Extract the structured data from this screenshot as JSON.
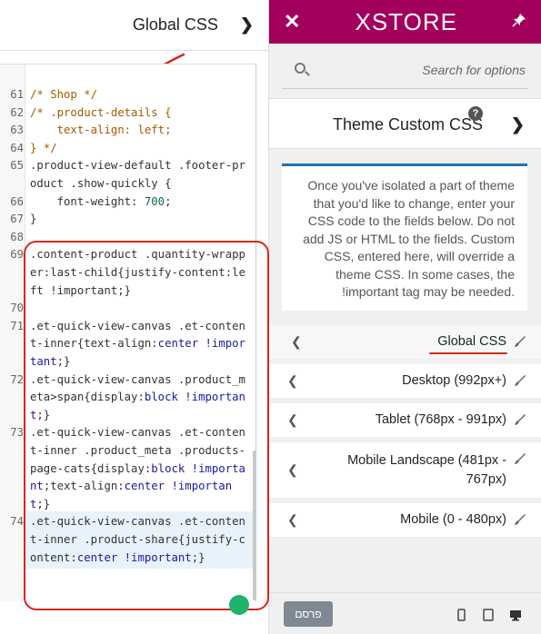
{
  "left_panel": {
    "title": "Global CSS",
    "code_lines": [
      {
        "n": "61",
        "parts": [
          {
            "t": "/* Shop */",
            "c": "cmt"
          }
        ]
      },
      {
        "n": "62",
        "parts": [
          {
            "t": "/* .product-details {",
            "c": "cmt"
          }
        ]
      },
      {
        "n": "63",
        "parts": [
          {
            "t": "    text-align: left;",
            "c": "cmt"
          }
        ]
      },
      {
        "n": "64",
        "parts": [
          {
            "t": "} */",
            "c": "cmt"
          }
        ]
      },
      {
        "n": "65",
        "parts": [
          {
            "t": ".product-view-default .footer-product .show-quickly {",
            "c": ""
          }
        ]
      },
      {
        "n": "66",
        "parts": [
          {
            "t": "    font-weight: ",
            "c": ""
          },
          {
            "t": "700",
            "c": "num"
          },
          {
            "t": ";",
            "c": ""
          }
        ]
      },
      {
        "n": "67",
        "parts": [
          {
            "t": "}",
            "c": ""
          }
        ]
      },
      {
        "n": "68",
        "parts": [
          {
            "t": "",
            "c": ""
          }
        ]
      },
      {
        "n": "69",
        "parts": [
          {
            "t": ".content-product .quantity-wrapper:last-child{justify-content:left !important;}",
            "c": ""
          }
        ]
      },
      {
        "n": "70",
        "parts": [
          {
            "t": "",
            "c": ""
          }
        ]
      },
      {
        "n": "71",
        "parts": [
          {
            "t": ".et-quick-view-canvas .et-content-inner{text-align:",
            "c": ""
          },
          {
            "t": "center !important",
            "c": "kw"
          },
          {
            "t": ";}",
            "c": ""
          }
        ]
      },
      {
        "n": "72",
        "parts": [
          {
            "t": ".et-quick-view-canvas .product_meta>span{display:",
            "c": ""
          },
          {
            "t": "block !important",
            "c": "kw"
          },
          {
            "t": ";}",
            "c": ""
          }
        ]
      },
      {
        "n": "73",
        "parts": [
          {
            "t": ".et-quick-view-canvas .et-content-inner .product_meta .products-page-cats{display:",
            "c": ""
          },
          {
            "t": "block !important",
            "c": "kw"
          },
          {
            "t": ";text-align:",
            "c": ""
          },
          {
            "t": "center !important",
            "c": "kw"
          },
          {
            "t": ";}",
            "c": ""
          }
        ]
      },
      {
        "n": "74",
        "parts": [
          {
            "t": ".et-quick-view-canvas .et-content-inner .product-share{justify-content:",
            "c": ""
          },
          {
            "t": "center !important",
            "c": "kw"
          },
          {
            "t": ";}",
            "c": ""
          }
        ]
      }
    ]
  },
  "topbar": {
    "logo": "XSTORE",
    "close_label": "✕",
    "pin_label": "📌"
  },
  "search": {
    "placeholder": "Search for options"
  },
  "section": {
    "title": "Theme Custom CSS",
    "help": "?"
  },
  "notice": "Once you've isolated a part of theme that you'd like to change, enter your CSS code to the fields below. Do not add JS or HTML to the fields. Custom CSS, entered here, will override a theme CSS. In some cases, the !important tag may be needed.",
  "nav": [
    {
      "label": "Global CSS"
    },
    {
      "label": "Desktop (992px+)"
    },
    {
      "label": "Tablet (768px - 991px)"
    },
    {
      "label": "Mobile Landscape (481px - 767px)"
    },
    {
      "label": "Mobile (0 - 480px)"
    }
  ],
  "footer": {
    "publish_label": "פרסם"
  },
  "colors": {
    "brand": "#a3005e",
    "annotation": "#d9261c"
  }
}
